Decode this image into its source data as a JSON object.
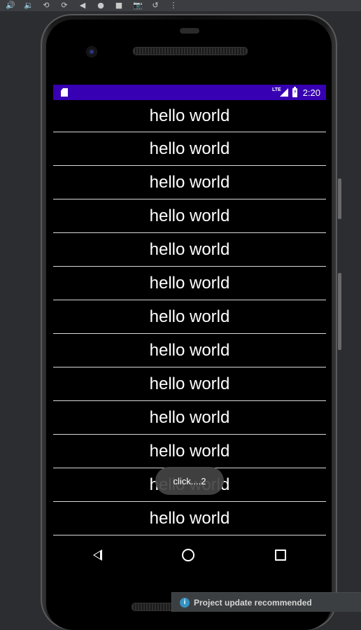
{
  "toolbar": {
    "icons": [
      "volume-up-icon",
      "volume-down-icon",
      "rotate-left-icon",
      "rotate-right-icon",
      "back-icon",
      "home-icon",
      "overview-icon",
      "screenshot-icon",
      "rewind-icon",
      "more-icon"
    ],
    "glyphs": [
      "🔊",
      "🔉",
      "⟲",
      "⟳",
      "◀",
      "●",
      "■",
      "📷",
      "↺",
      "⋮"
    ]
  },
  "status_bar": {
    "network": "LTE",
    "time": "2:20",
    "color": "#3700b3"
  },
  "list": {
    "items": [
      "hello world",
      "hello world",
      "hello world",
      "hello world",
      "hello world",
      "hello world",
      "hello world",
      "hello world",
      "hello world",
      "hello world",
      "hello world",
      "hello world",
      "hello world"
    ]
  },
  "toast": {
    "text": "click....2"
  },
  "notification": {
    "icon": "info-icon",
    "glyph": "i",
    "text": "Project update recommended",
    "accent": "#3592c4"
  }
}
